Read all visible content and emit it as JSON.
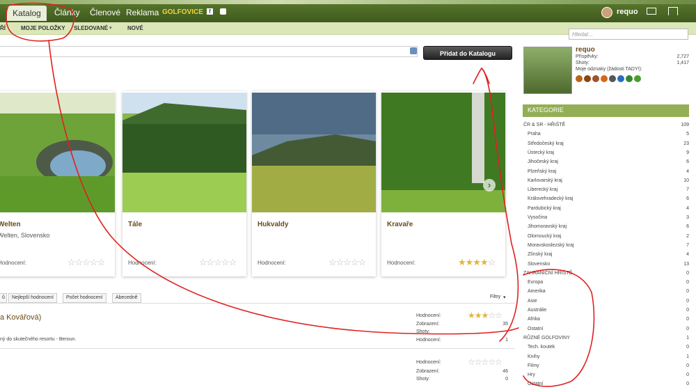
{
  "nav": {
    "katalog": "Katalog",
    "clanky": "Články",
    "clenove": "Členové",
    "reklama": "Reklama",
    "logo": "GOLFOVICE",
    "user": "requo"
  },
  "subnav": {
    "a": "ŘÍ",
    "b": "MOJE POLOŽKY",
    "c": "SLEDOVANÉ",
    "d": "NOVÉ"
  },
  "search": {
    "placeholder": "Hledat..."
  },
  "add_button": "Přidat do Katalogu",
  "cards": [
    {
      "title": "Welten",
      "sub": "Welten, Slovensko",
      "rating_label": "Hodnocení:",
      "stars": 0
    },
    {
      "title": "Tále",
      "sub": "",
      "rating_label": "Hodnocení:",
      "stars": 0
    },
    {
      "title": "Hukvaldy",
      "sub": "",
      "rating_label": "Hodnocení:",
      "stars": 0
    },
    {
      "title": "Kravaře",
      "sub": "",
      "rating_label": "Hodnocení:",
      "stars": 4
    }
  ],
  "sort_tabs": [
    "ů",
    "Nejlepší hodnocení",
    "Počet hodnocení",
    "Abecedně"
  ],
  "filters": "Filtry",
  "list": [
    {
      "title": "a Kovářová)",
      "desc": "ný do skutečného resortu - Beroun.",
      "rating": "Hodnocení:",
      "views_label": "Zobrazení:",
      "views": "35",
      "shots_label": "Shoty:",
      "rating2": "Hodnocení:",
      "rating2_val": "1"
    },
    {
      "rating": "Hodnocení:",
      "views_label": "Zobrazení:",
      "views": "46",
      "shots_label": "Shoty:",
      "shots": "0"
    }
  ],
  "profile": {
    "name": "requo",
    "posts_label": "Příspěvky:",
    "posts": "2,727",
    "shots_label": "Shoty:",
    "shots": "1,417",
    "badges_label": "Moje odznaky (žádosti TADY!):"
  },
  "categories_header": "KATEGORIE",
  "categories": [
    {
      "name": "ČR & SR - HŘIŠTĚ",
      "n": "109",
      "top": true
    },
    {
      "name": "Praha",
      "n": "5"
    },
    {
      "name": "Středočeský kraj",
      "n": "23"
    },
    {
      "name": "Ústecký kraj",
      "n": "9"
    },
    {
      "name": "Jihočeský kraj",
      "n": "6"
    },
    {
      "name": "Plzeňský kraj",
      "n": "4"
    },
    {
      "name": "Karlovarský kraj",
      "n": "10"
    },
    {
      "name": "Liberecký kraj",
      "n": "7"
    },
    {
      "name": "Královehradecký kraj",
      "n": "6"
    },
    {
      "name": "Pardubický kraj",
      "n": "4"
    },
    {
      "name": "Vysočina",
      "n": "3"
    },
    {
      "name": "Jihomoravský kraj",
      "n": "6"
    },
    {
      "name": "Olomoucký kraj",
      "n": "2"
    },
    {
      "name": "Moravskoslezský kraj",
      "n": "7"
    },
    {
      "name": "Zlínský kraj",
      "n": "4"
    },
    {
      "name": "Slovensko",
      "n": "13"
    },
    {
      "name": "ZAHRANIČNÍ HŘIŠTĚ",
      "n": "0",
      "top": true
    },
    {
      "name": "Evropa",
      "n": "0"
    },
    {
      "name": "Amerika",
      "n": "0"
    },
    {
      "name": "Asie",
      "n": "0"
    },
    {
      "name": "Austrálie",
      "n": "0"
    },
    {
      "name": "Afrika",
      "n": "0"
    },
    {
      "name": "Ostatní",
      "n": "0"
    },
    {
      "name": "RŮZNÉ GOLFOVINY",
      "n": "1",
      "top": true
    },
    {
      "name": "Tech. koutek",
      "n": "0"
    },
    {
      "name": "Knihy",
      "n": "1"
    },
    {
      "name": "Filmy",
      "n": "0"
    },
    {
      "name": "Hry",
      "n": "0"
    },
    {
      "name": "Ostatní",
      "n": "0"
    }
  ]
}
